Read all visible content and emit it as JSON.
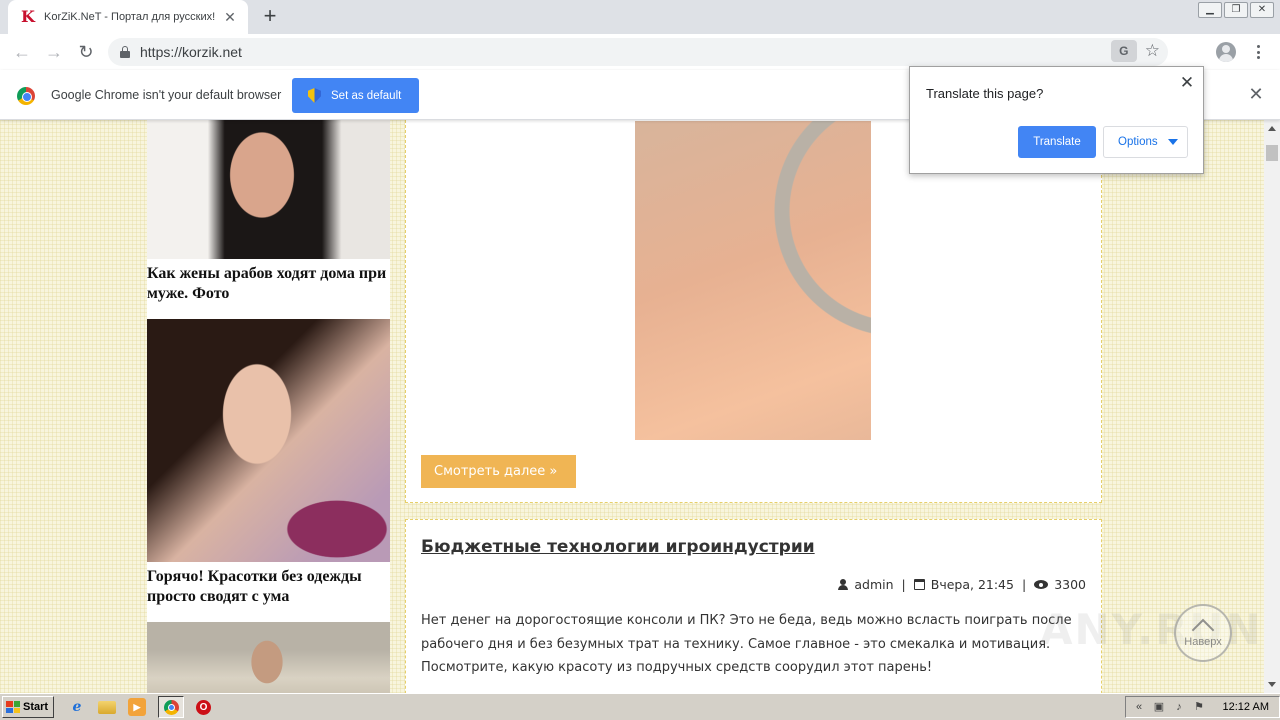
{
  "browser": {
    "tab": {
      "title": "KorZiK.NeT - Портал для русских!",
      "favicon": "K"
    },
    "url": "https://korzik.net"
  },
  "infobar": {
    "text": "Google Chrome isn't your default browser",
    "button": "Set as default"
  },
  "translate_bubble": {
    "title": "Translate this page?",
    "translate_button": "Translate",
    "options_button": "Options"
  },
  "sidebar": {
    "items": [
      {
        "caption": "Как жены арабов ходят дома при муже. Фото"
      },
      {
        "caption": "Горячо! Красотки без одежды просто сводят с ума"
      }
    ]
  },
  "posts": {
    "first": {
      "more_button": "Смотреть далее »"
    },
    "second": {
      "title": "Бюджетные технологии игроиндустрии",
      "author": "admin",
      "date": "Вчера, 21:45",
      "views": "3300",
      "text": "Нет денег на дорогостоящие консоли и ПК? Это не беда, ведь можно всласть поиграть после рабочего дня и без безумных трат на технику. Самое главное - это смекалка и мотивация. Посмотрите, какую красоту из подручных средств соорудил этот парень!"
    }
  },
  "to_top": {
    "label": "Наверх"
  },
  "watermark": "ANY.RUN",
  "taskbar": {
    "start": "Start",
    "clock": "12:12 AM"
  },
  "colors": {
    "accent": "#4285f4",
    "more_button": "#f0b554",
    "page_bg": "#f8f5dd"
  }
}
